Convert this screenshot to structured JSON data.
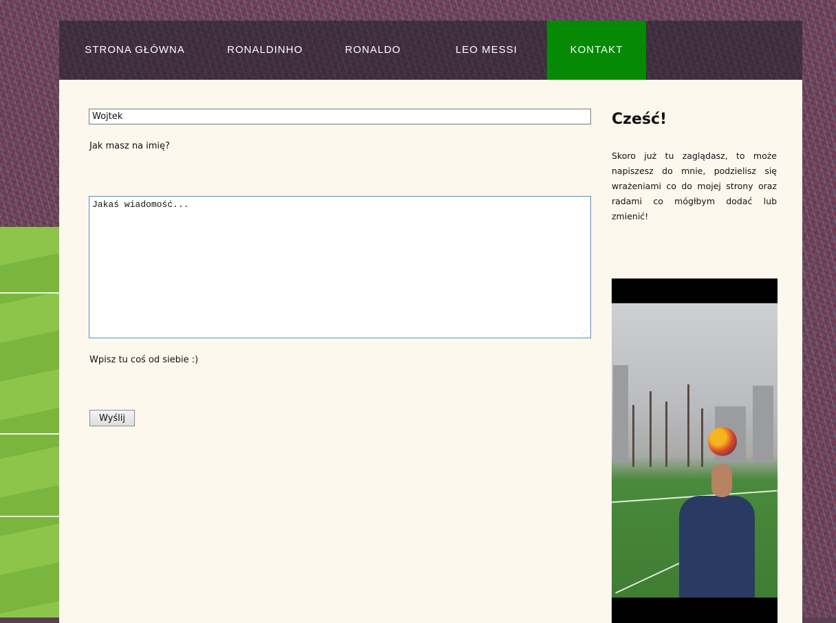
{
  "nav": {
    "items": [
      {
        "label": "STRONA GŁÓWNA"
      },
      {
        "label": "RONALDINHO"
      },
      {
        "label": "RONALDO"
      },
      {
        "label": "LEO MESSI"
      },
      {
        "label": "KONTAKT",
        "active": true
      }
    ],
    "active_color": "#068a06"
  },
  "form": {
    "name_value": "Wojtek",
    "name_label": "Jak masz na imię?",
    "message_placeholder": "Jakaś wiadomość...",
    "message_label": "Wpisz tu coś od siebie :)",
    "send_label": "Wyślij"
  },
  "sidebar": {
    "title": "Cześć!",
    "text": "Skoro już tu zaglądasz, to może napiszesz do mnie, podzielisz się wrażeniami co do mojej strony oraz radami co mógłbym dodać lub zmienić!"
  },
  "colors": {
    "content_bg": "#fdf8ee",
    "input_focus_border": "#4a90d9"
  }
}
